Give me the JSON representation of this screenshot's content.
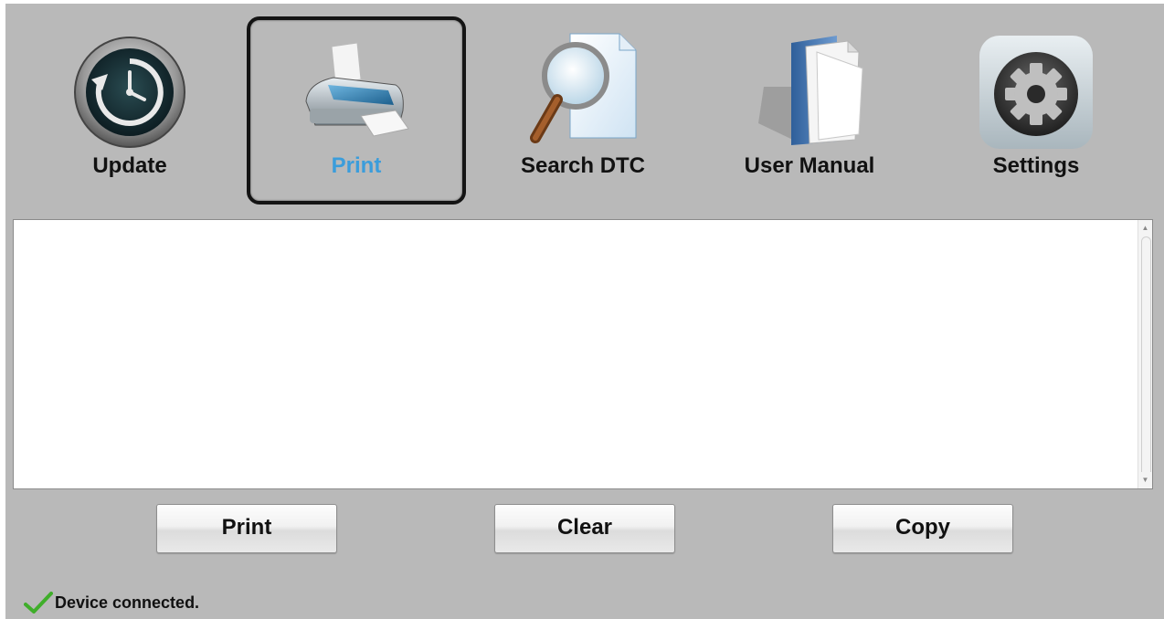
{
  "toolbar": {
    "items": [
      {
        "label": "Update",
        "icon": "update-clock-icon",
        "selected": false
      },
      {
        "label": "Print",
        "icon": "printer-icon",
        "selected": true
      },
      {
        "label": "Search DTC",
        "icon": "search-document-icon",
        "selected": false
      },
      {
        "label": "User Manual",
        "icon": "manual-book-icon",
        "selected": false
      },
      {
        "label": "Settings",
        "icon": "gear-icon",
        "selected": false
      }
    ]
  },
  "output": {
    "text": ""
  },
  "actions": {
    "print_label": "Print",
    "clear_label": "Clear",
    "copy_label": "Copy"
  },
  "status": {
    "text": "Device connected.",
    "icon": "checkmark-icon",
    "color": "#3fae2a"
  },
  "colors": {
    "background": "#b9b9b9",
    "selected_label": "#3b9ddb"
  }
}
